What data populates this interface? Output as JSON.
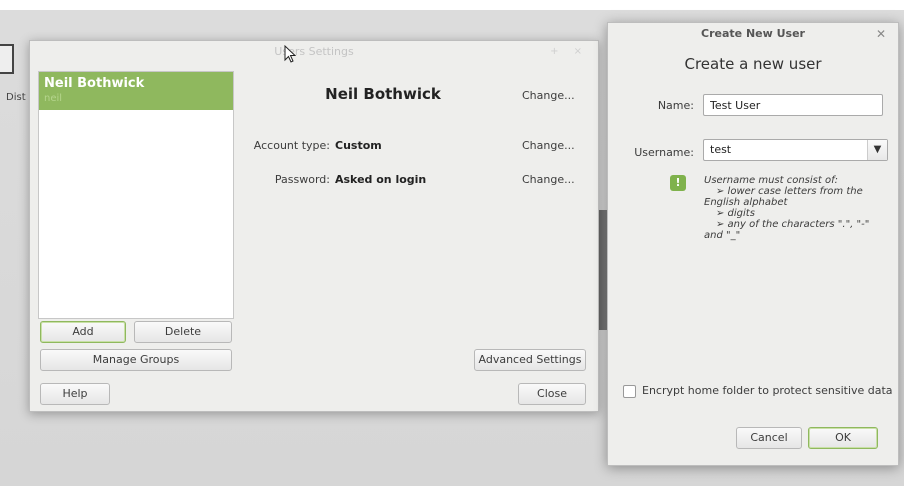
{
  "desktop": {
    "icon_label": "Dist"
  },
  "users_window": {
    "title": "Users Settings",
    "user_list": [
      {
        "name": "Neil Bothwick",
        "subtitle": "neil"
      }
    ],
    "selected_user_name": "Neil Bothwick",
    "account_type_label": "Account type:",
    "account_type_value": "Custom",
    "password_label": "Password:",
    "password_value": "Asked on login",
    "change_label": "Change...",
    "buttons": {
      "add": "Add",
      "delete": "Delete",
      "manage_groups": "Manage Groups",
      "help": "Help",
      "advanced_settings": "Advanced Settings",
      "close": "Close"
    }
  },
  "create_dialog": {
    "title": "Create New User",
    "heading": "Create a new user",
    "name_label": "Name:",
    "name_value": "Test User",
    "username_label": "Username:",
    "username_value": "test",
    "hint_lines": [
      "Username must consist of:",
      "➢ lower case letters from the",
      "English alphabet",
      "➢ digits",
      "➢ any of the characters \".\", \"-\"",
      "and \"_\""
    ],
    "encrypt_label": "Encrypt home folder to protect sensitive data",
    "encrypt_checked": false,
    "cancel": "Cancel",
    "ok": "OK"
  },
  "colors": {
    "accent_green": "#8fb85e",
    "window_bg": "#eeeeec"
  },
  "icons": [
    "close-icon",
    "info-icon",
    "chevron-down-icon",
    "mouse-cursor-icon"
  ]
}
